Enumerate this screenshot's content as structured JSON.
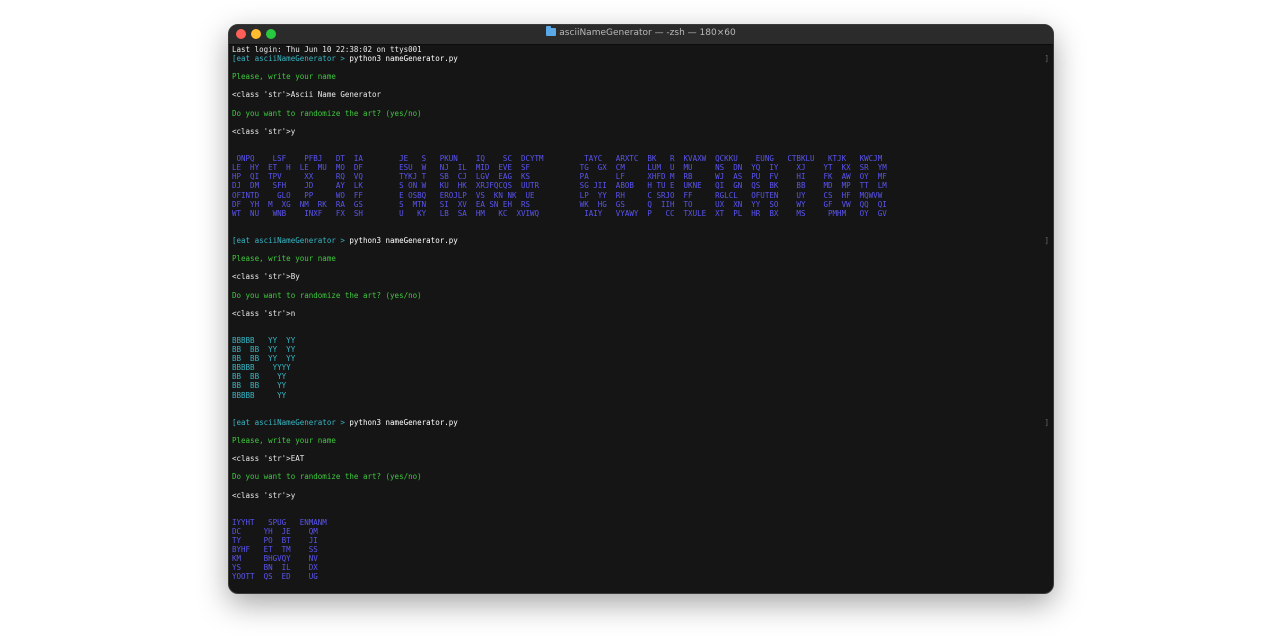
{
  "window": {
    "title": "asciiNameGenerator — -zsh — 180×60"
  },
  "terminal": {
    "last_login": "Last login: Thu Jun 10 22:38:02 on ttys001",
    "sessions": [
      {
        "prompt": "[eat asciiNameGenerator > ",
        "command": "python3 nameGenerator.py",
        "ask_name": "Please, write your name",
        "name_echo": "<class 'str'>Ascii Name Generator",
        "ask_random": "Do you want to randomize the art? (yes/no)",
        "random_echo": "<class 'str'>y",
        "art_color": "#5a55f0",
        "art": [
          " ONPQ    LSF    PFBJ   DT  IA        JE   S   PKUN    IQ    SC  DCYTM         TAYC   ARXTC  BK   R  KVAXW  QCKKU    EUNG   CTBKLU   KTJK   KWCJM",
          "LE  HY  ET  H  LE  MU  MO  DF        ESU  W   NJ  IL  MID  EVE  SF           TG  GX  CM     LUM  U  MU     NS  DN  YQ  IY    XJ    YT  KX  SR  YM",
          "HP  QI  TPV     XX     RQ  VQ        TYKJ T   SB  CJ  LGV  EAG  KS           PA      LF     XHFD M  RB     WJ  AS  PU  FV    HI    FK  AW  OY  MF",
          "DJ  DM   SFH    JD     AY  LK        S ON W   KU  HK  XRJFQCQS  UUTR         SG JII  ABOB   H TU E  UKNE   QI  GN  QS  BK    BB    MD  MP  TT  LM",
          "OFINTD    GLO   PP     WO  FF        E OSBQ   EROJLP  VS  KN NK  UE          LP  YY  RH     C SRJO  FF     RGLCL   OFUTEN    UY    CS  HF  MQWVW",
          "DF  YH  M  XG  NM  RK  RA  GS        S  MTN   SI  XV  EA SN EH  RS           WK  HG  GS     Q  IIH  TO     UX  XN  YY  SO    WY    GF  VW  QQ  QI",
          "WT  NU   WNB    INXF   FX  SH        U   KY   LB  SA  HM   KC  XVIWQ          IAIY   VYAWY  P   CC  TXULE  XT  PL  HR  BX    MS     PMHM   OY  GV"
        ]
      },
      {
        "prompt": "[eat asciiNameGenerator > ",
        "command": "python3 nameGenerator.py",
        "ask_name": "Please, write your name",
        "name_echo": "<class 'str'>By",
        "ask_random": "Do you want to randomize the art? (yes/no)",
        "random_echo": "<class 'str'>n",
        "art_color": "#36b6c4",
        "art": [
          "BBBBB   YY  YY",
          "BB  BB  YY  YY",
          "BB  BB  YY  YY",
          "BBBBB    YYYY",
          "BB  BB    YY",
          "BB  BB    YY",
          "BBBBB     YY"
        ]
      },
      {
        "prompt": "[eat asciiNameGenerator > ",
        "command": "python3 nameGenerator.py",
        "ask_name": "Please, write your name",
        "name_echo": "<class 'str'>EAT",
        "ask_random": "Do you want to randomize the art? (yes/no)",
        "random_echo": "<class 'str'>y",
        "art_color": "#5a55f0",
        "art": [
          "IYYHT   SPUG   ENMANM",
          "DC     YH  JE    QM",
          "TY     PO  BT    JI",
          "BYHF   ET  TM    SS",
          "KM     BHGVQY    NV",
          "YS     BN  IL    DX",
          "YOOTT  QS  ED    UG"
        ]
      }
    ],
    "bracket_glyph": "]"
  }
}
